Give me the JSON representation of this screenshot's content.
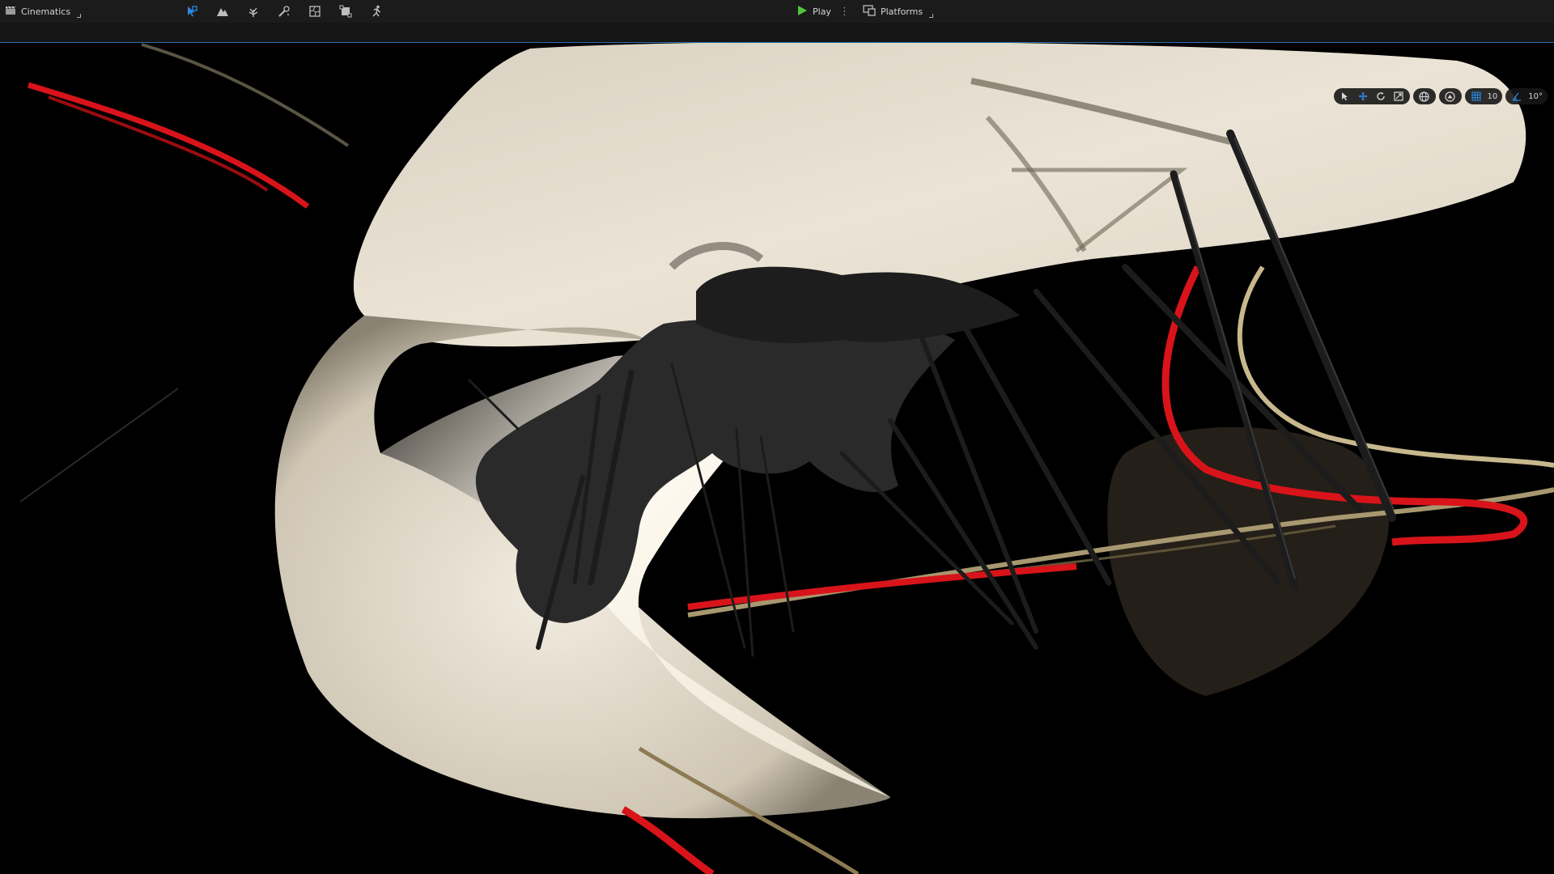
{
  "toolbar": {
    "cinematics_label": "Cinematics",
    "play_label": "Play",
    "platforms_label": "Platforms",
    "mode_icons": [
      "select-mode-icon",
      "landscape-mode-icon",
      "foliage-mode-icon",
      "mesh-paint-mode-icon",
      "fracture-mode-icon",
      "modeling-mode-icon",
      "animation-mode-icon"
    ]
  },
  "viewport": {
    "grid_snap_value": "10",
    "rotation_snap_value": "10°"
  },
  "colors": {
    "accent_blue": "#2b8ae6",
    "play_green": "#4fc83a",
    "cloth": "#e8e0d0",
    "red_cable": "#d8141a"
  }
}
